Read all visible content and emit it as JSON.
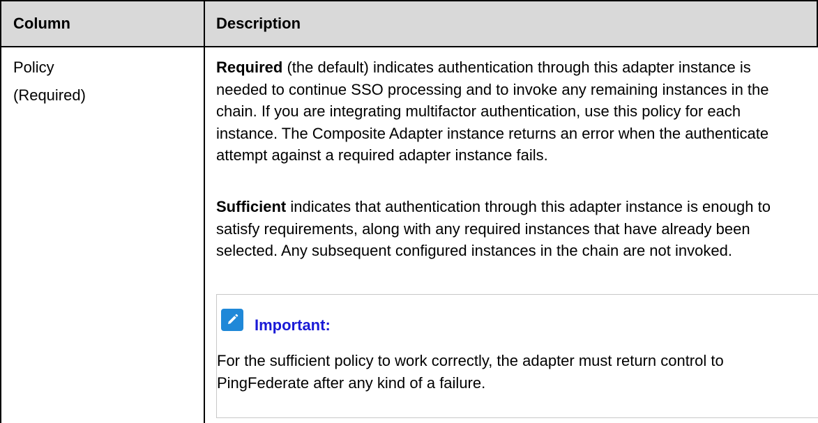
{
  "header": {
    "col1": "Column",
    "col2": "Description"
  },
  "row": {
    "name": "Policy",
    "qualifier": "(Required)",
    "required_term": "Required",
    "required_text": " (the default) indicates authentication through this adapter instance is needed to continue SSO processing and to invoke any remaining instances in the chain. If you are integrating multifactor authentication, use this policy for each instance. The Composite Adapter instance returns an error when the authenticate attempt against a required adapter instance fails.",
    "sufficient_term": "Sufficient",
    "sufficient_text": " indicates that authentication through this adapter instance is enough to satisfy requirements, along with any required instances that have already been selected. Any subsequent configured instances in the chain are not invoked."
  },
  "note": {
    "icon": "pencil-note-icon",
    "title": "Important",
    "colon": ":",
    "body": "For the sufficient policy to work correctly, the adapter must return control to PingFederate after any kind of a failure.",
    "accent_color": "#1f88d8",
    "title_color": "#1a1ad6"
  }
}
